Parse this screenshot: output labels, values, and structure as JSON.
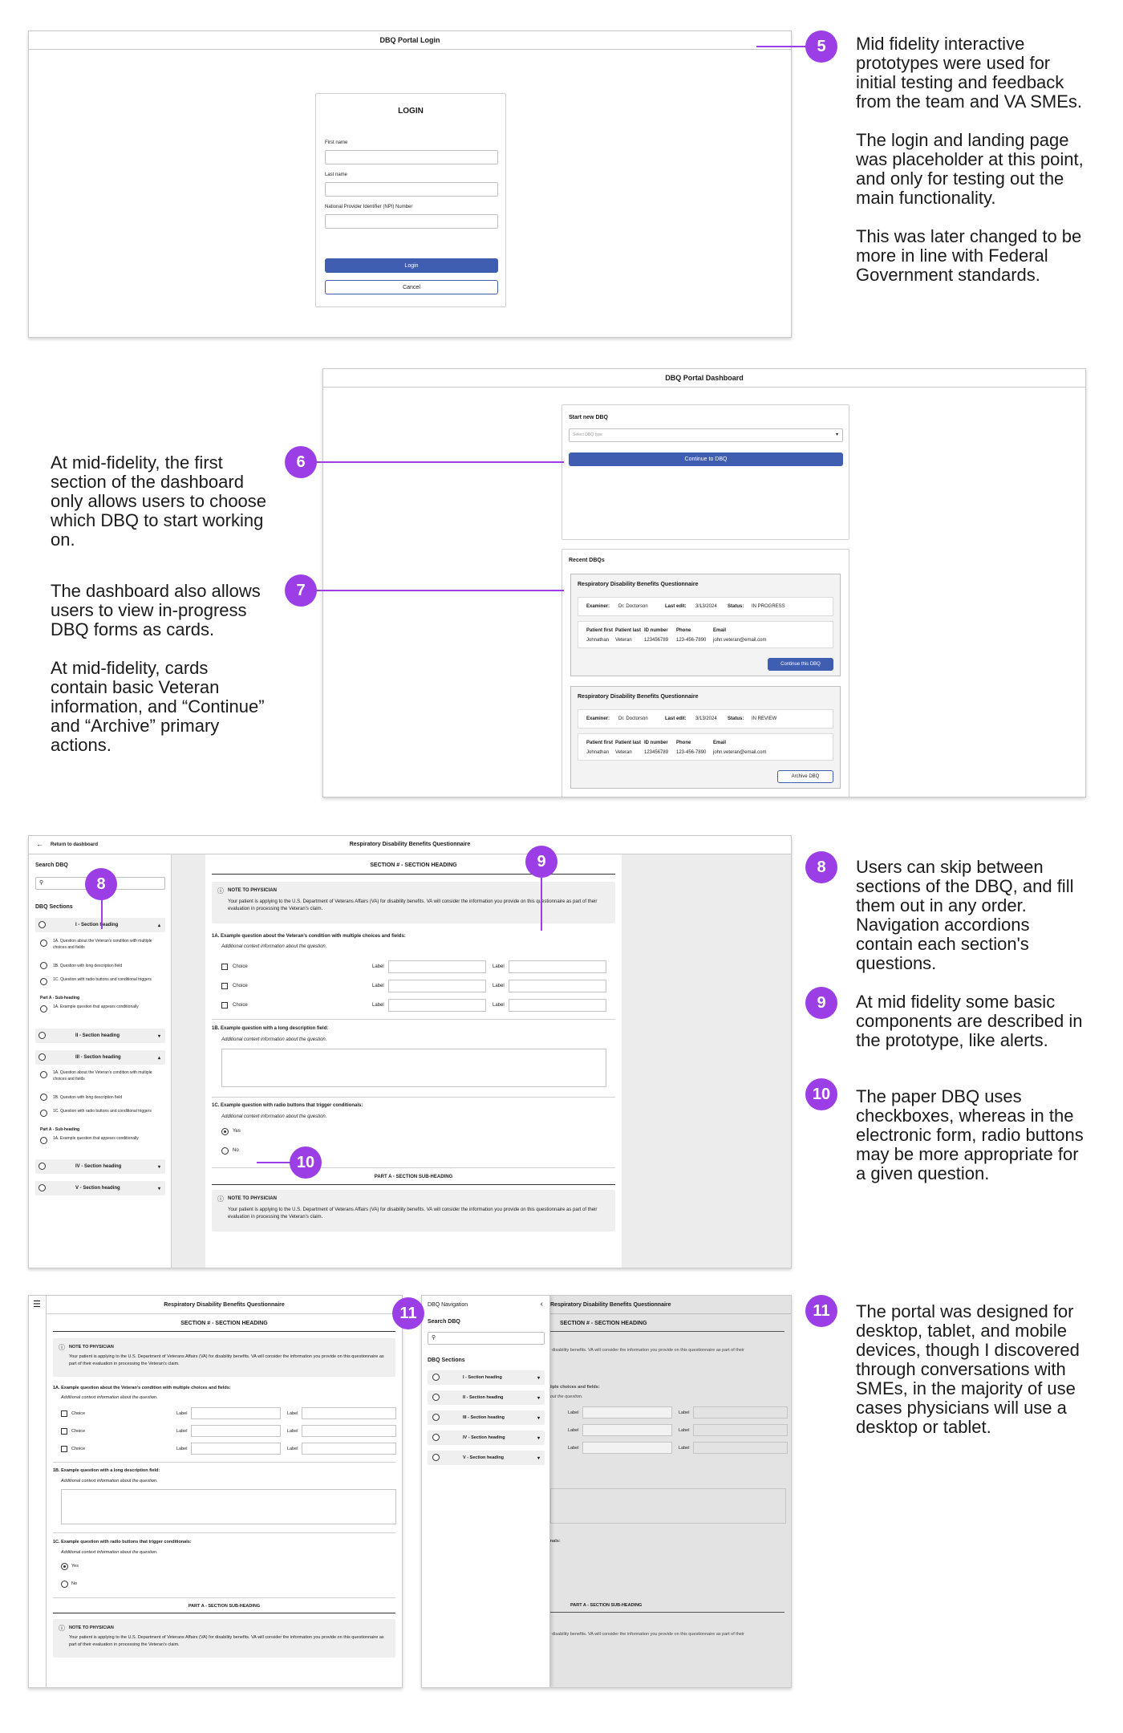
{
  "colors": {
    "accent": "#9b3ee6",
    "primary_button": "#3f5db1"
  },
  "login": {
    "window_title": "DBQ Portal Login",
    "heading": "LOGIN",
    "first_name_label": "First name",
    "last_name_label": "Last name",
    "npi_label": "National Provider Identifier (NPI) Number",
    "login_button": "Login",
    "cancel_button": "Cancel"
  },
  "dashboard": {
    "window_title": "DBQ Portal Dashboard",
    "start_heading": "Start new DBQ",
    "select_placeholder": "Select DBQ type",
    "continue_button": "Continue to DBQ",
    "recent_heading": "Recent DBQs",
    "cards": [
      {
        "title": "Respiratory Disability Benefits Questionnaire",
        "examiner_label": "Examiner:",
        "examiner": "Dr. Doctorson",
        "last_edit_label": "Last edit:",
        "last_edit": "3/13/2024",
        "status_label": "Status:",
        "status": "IN PROGRESS",
        "cols": [
          "Patient first",
          "Patient last",
          "ID number",
          "Phone",
          "Email"
        ],
        "vals": [
          "Johnathan",
          "Veteran",
          "123456789",
          "123-456-7890",
          "john.veteran@email.com"
        ],
        "action": "Continue this DBQ"
      },
      {
        "title": "Respiratory Disability Benefits Questionnaire",
        "examiner_label": "Examiner:",
        "examiner": "Dr. Doctorson",
        "last_edit_label": "Last edit:",
        "last_edit": "3/13/2024",
        "status_label": "Status:",
        "status": "IN REVIEW",
        "cols": [
          "Patient first",
          "Patient last",
          "ID number",
          "Phone",
          "Email"
        ],
        "vals": [
          "Johnathan",
          "Veteran",
          "123456789",
          "123-456-7890",
          "john.veteran@email.com"
        ],
        "action": "Archive DBQ"
      }
    ]
  },
  "form": {
    "return_link": "Return to dashboard",
    "title": "Respiratory Disability Benefits Questionnaire",
    "search_label": "Search DBQ",
    "sections_label": "DBQ Sections",
    "nav_label": "DBQ Navigation",
    "sections": [
      "I - Section heading",
      "II - Section heading",
      "III - Section heading",
      "IV - Section heading",
      "V - Section heading"
    ],
    "sub_items": [
      "1A. Question about the Veteran's condition with multiple choices and fields",
      "1B. Question with long description field",
      "1C. Question with radio buttons and conditional triggers"
    ],
    "part_a": "Part A - Sub-heading",
    "part_a_item": "1A. Example question that appears conditionally",
    "section_heading": "SECTION # - SECTION HEADING",
    "note_title": "NOTE TO PHYSICIAN",
    "note_text": "Your patient is applying to the U.S. Department of Veterans Affairs (VA) for disability benefits. VA will consider the information you provide on this questionnaire as part of their evaluation in processing the Veteran's claim.",
    "q1a": "1A. Example question about the Veteran's condition with multiple choices and fields:",
    "context": "Additional context information about the question.",
    "choice": "Choice",
    "label": "Label",
    "q1b": "1B. Example question with a long description field:",
    "q1c": "1C. Example question with radio buttons that trigger conditionals:",
    "yes": "Yes",
    "no": "No",
    "subheading": "PART A - SECTION SUB-HEADING"
  },
  "annotations": {
    "a5": [
      "Mid fidelity interactive prototypes were used for initial testing and feedback from the team and VA SMEs.",
      "The login and landing page was placeholder at this point, and only for testing out the main functionality.",
      "This was later changed to be more in line with Federal Government standards."
    ],
    "a6": "At mid-fidelity, the first section of the dashboard only allows users to choose which DBQ to start working on.",
    "a7": [
      "The dashboard also allows users to view in-progress DBQ forms as cards.",
      "At mid-fidelity, cards contain basic Veteran information, and “Continue” and “Archive” primary actions."
    ],
    "a8": "Users can skip between sections of the DBQ, and fill them out in any order. Navigation accordions contain each section's questions.",
    "a9": "At mid fidelity some basic components are described in the prototype, like alerts.",
    "a10": "The paper DBQ uses checkboxes, whereas in the electronic form, radio buttons may be more appropriate for a given question.",
    "a11": "The portal was designed for desktop, tablet, and mobile devices, though I discovered through conversations with SMEs, in the majority of use cases physicians will use a desktop or tablet.",
    "badges": [
      "5",
      "6",
      "7",
      "8",
      "9",
      "10",
      "11"
    ]
  }
}
